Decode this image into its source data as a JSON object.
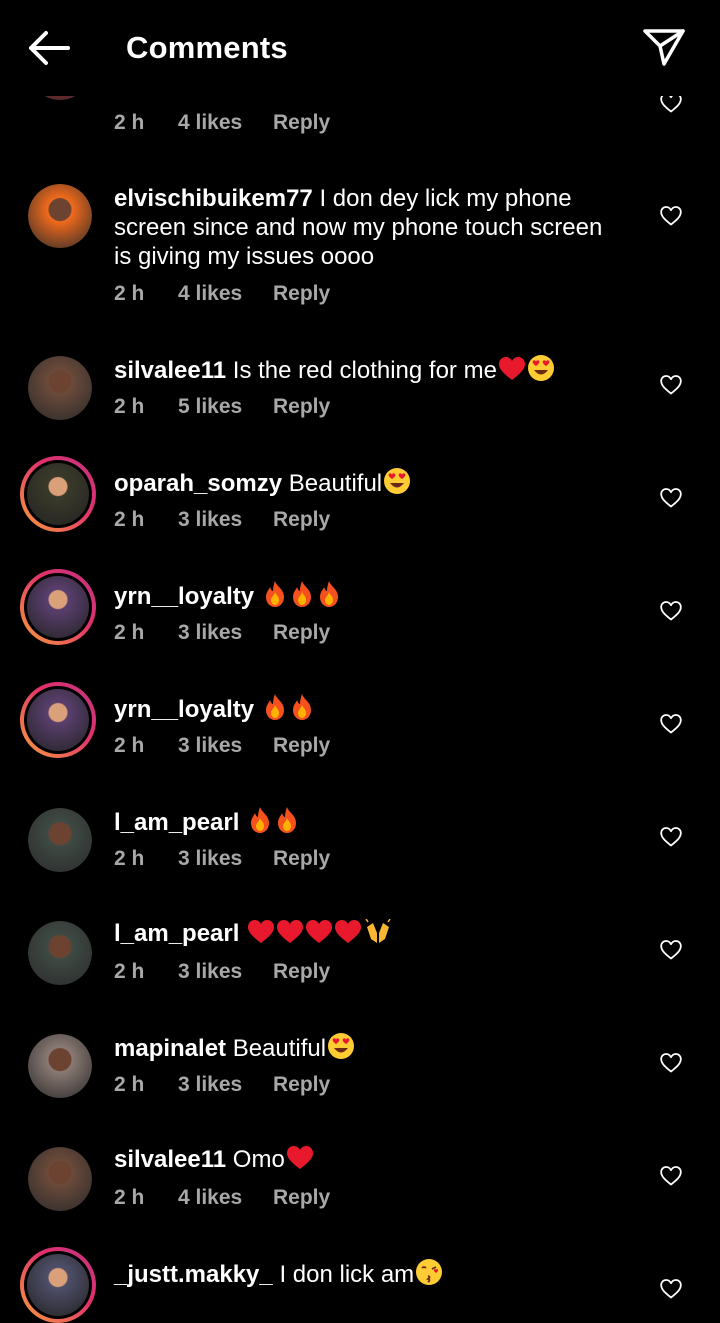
{
  "header": {
    "title": "Comments",
    "back_icon": "arrow-left-icon",
    "share_icon": "paper-plane-icon"
  },
  "comments": [
    {
      "username": "",
      "text": "",
      "time": "2 h",
      "likes": "4 likes",
      "reply": "Reply",
      "avatar_color": "#b4262f",
      "story_ring": false,
      "emojis": []
    },
    {
      "username": "elvischibuikem77",
      "text": "I don dey lick my phone screen since and now my phone touch screen is giving my issues oooo",
      "time": "2 h",
      "likes": "4 likes",
      "reply": "Reply",
      "avatar_color": "#f26a1b",
      "story_ring": false,
      "emojis": []
    },
    {
      "username": "silvalee11",
      "text": "Is the red clothing for me",
      "time": "2 h",
      "likes": "5 likes",
      "reply": "Reply",
      "avatar_color": "#6b4a3a",
      "story_ring": false,
      "emojis": [
        "red-heart",
        "heart-eyes"
      ]
    },
    {
      "username": "oparah_somzy",
      "text": "Beautiful",
      "time": "2 h",
      "likes": "3 likes",
      "reply": "Reply",
      "avatar_color": "#3a3a2a",
      "story_ring": true,
      "emojis": [
        "heart-eyes"
      ]
    },
    {
      "username": "yrn__loyalty",
      "text": "",
      "time": "2 h",
      "likes": "3 likes",
      "reply": "Reply",
      "avatar_color": "#5a3f6e",
      "story_ring": true,
      "emojis": [
        "fire",
        "fire",
        "fire"
      ]
    },
    {
      "username": "yrn__loyalty",
      "text": "",
      "time": "2 h",
      "likes": "3 likes",
      "reply": "Reply",
      "avatar_color": "#5a3f6e",
      "story_ring": true,
      "emojis": [
        "fire",
        "fire"
      ]
    },
    {
      "username": "l_am_pearl",
      "text": "",
      "time": "2 h",
      "likes": "3 likes",
      "reply": "Reply",
      "avatar_color": "#3f4a44",
      "story_ring": false,
      "emojis": [
        "fire",
        "fire"
      ]
    },
    {
      "username": "l_am_pearl",
      "text": "",
      "time": "2 h",
      "likes": "3 likes",
      "reply": "Reply",
      "avatar_color": "#3f4a44",
      "story_ring": false,
      "emojis": [
        "red-heart",
        "red-heart",
        "red-heart",
        "red-heart",
        "raised-hands"
      ]
    },
    {
      "username": "mapinalet",
      "text": "Beautiful",
      "time": "2 h",
      "likes": "3 likes",
      "reply": "Reply",
      "avatar_color": "#8a7a74",
      "story_ring": false,
      "emojis": [
        "heart-eyes"
      ]
    },
    {
      "username": "silvalee11",
      "text": "Omo",
      "time": "2 h",
      "likes": "4 likes",
      "reply": "Reply",
      "avatar_color": "#6b4a3a",
      "story_ring": false,
      "emojis": [
        "red-heart"
      ]
    },
    {
      "username": "_justt.makky_",
      "text": "I don lick am",
      "time": "",
      "likes": "",
      "reply": "",
      "avatar_color": "#4f4f6a",
      "story_ring": true,
      "emojis": [
        "kissing-face"
      ]
    }
  ],
  "colors": {
    "background": "#000000",
    "meta_text": "#a8a8a8",
    "story_ring_start": "#f9a03c",
    "story_ring_end": "#c13584"
  }
}
